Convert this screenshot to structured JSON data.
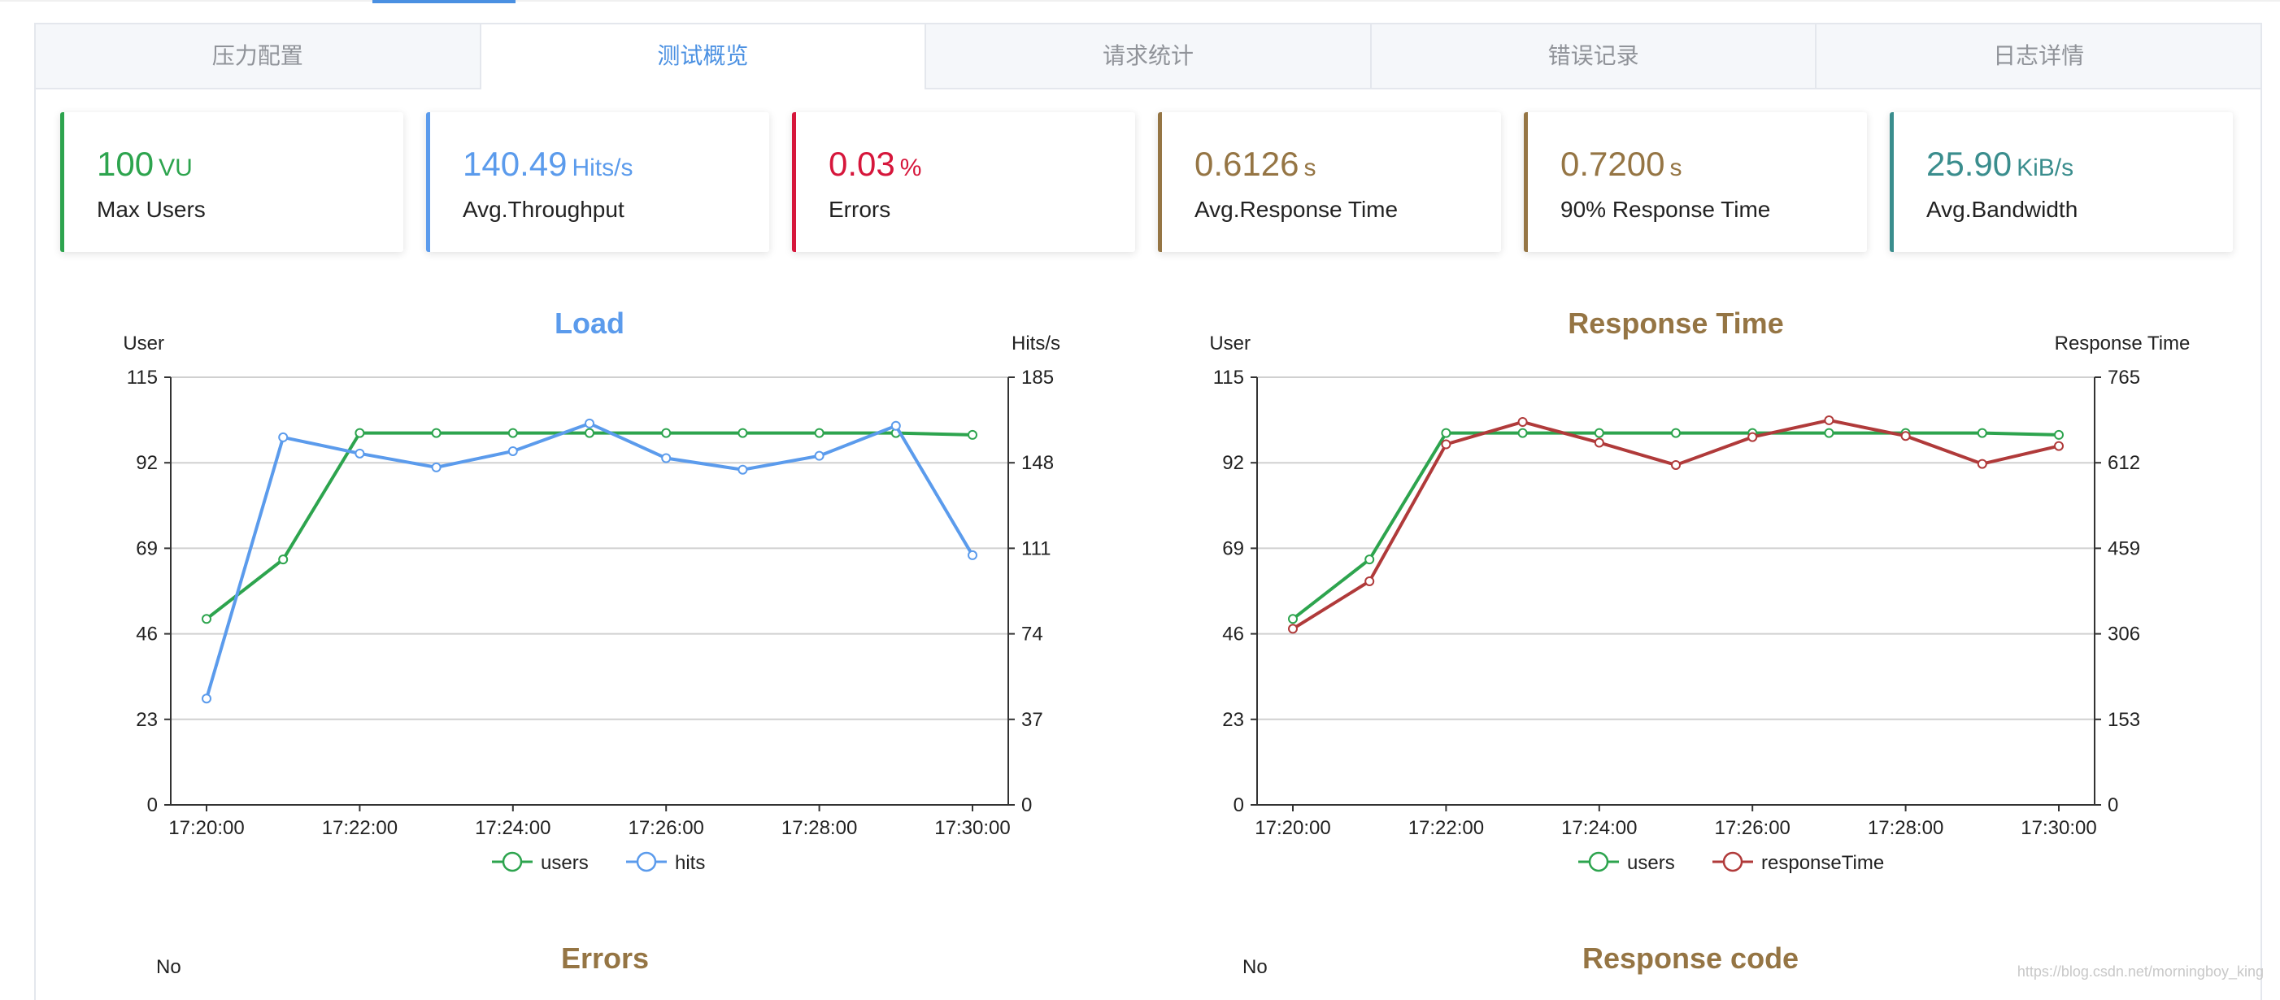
{
  "tabs": [
    {
      "label": "压力配置"
    },
    {
      "label": "测试概览"
    },
    {
      "label": "请求统计"
    },
    {
      "label": "错误记录"
    },
    {
      "label": "日志详情"
    }
  ],
  "cards": [
    {
      "value": "100",
      "unit": "VU",
      "label": "Max Users",
      "color": "#2da44e"
    },
    {
      "value": "140.49",
      "unit": "Hits/s",
      "label": "Avg.Throughput",
      "color": "#5b9bec"
    },
    {
      "value": "0.03",
      "unit": "%",
      "label": "Errors",
      "color": "#d6163b"
    },
    {
      "value": "0.6126",
      "unit": "s",
      "label": "Avg.Response Time",
      "color": "#957544"
    },
    {
      "value": "0.7200",
      "unit": "s",
      "label": "90% Response Time",
      "color": "#957544"
    },
    {
      "value": "25.90",
      "unit": "KiB/s",
      "label": "Avg.Bandwidth",
      "color": "#3a8d8d"
    }
  ],
  "chart_data": [
    {
      "type": "line",
      "title": "Load",
      "title_color": "#5b9bec",
      "ylabel_left": "User",
      "ylabel_right": "Hits/s",
      "x_ticks": [
        "17:20:00",
        "17:22:00",
        "17:24:00",
        "17:26:00",
        "17:28:00",
        "17:30:00"
      ],
      "x": [
        "17:20:00",
        "17:21:00",
        "17:22:00",
        "17:23:00",
        "17:24:00",
        "17:25:00",
        "17:26:00",
        "17:27:00",
        "17:28:00",
        "17:29:00",
        "17:30:00"
      ],
      "y_left_ticks": [
        0,
        23,
        46,
        69,
        92,
        115
      ],
      "y_right_ticks": [
        0,
        37,
        74,
        111,
        148,
        185
      ],
      "ylim_left": [
        0,
        115
      ],
      "ylim_right": [
        0,
        185
      ],
      "grid": true,
      "legend_position": "bottom-center",
      "series": [
        {
          "name": "users",
          "axis": "left",
          "color": "#2da44e",
          "values": [
            50,
            66,
            100,
            100,
            100,
            100,
            100,
            100,
            100,
            100,
            99.5
          ]
        },
        {
          "name": "hits",
          "axis": "right",
          "color": "#5b9bec",
          "values": [
            46,
            159,
            152,
            146,
            153,
            165,
            150,
            145,
            151,
            164,
            108
          ]
        }
      ]
    },
    {
      "type": "line",
      "title": "Response Time",
      "title_color": "#957544",
      "ylabel_left": "User",
      "ylabel_right": "Response Time",
      "x_ticks": [
        "17:20:00",
        "17:22:00",
        "17:24:00",
        "17:26:00",
        "17:28:00",
        "17:30:00"
      ],
      "x": [
        "17:20:00",
        "17:21:00",
        "17:22:00",
        "17:23:00",
        "17:24:00",
        "17:25:00",
        "17:26:00",
        "17:27:00",
        "17:28:00",
        "17:29:00",
        "17:30:00"
      ],
      "y_left_ticks": [
        0,
        23,
        46,
        69,
        92,
        115
      ],
      "y_right_ticks": [
        0,
        153,
        306,
        459,
        612,
        765
      ],
      "ylim_left": [
        0,
        115
      ],
      "ylim_right": [
        0,
        765
      ],
      "grid": true,
      "legend_position": "bottom-center",
      "series": [
        {
          "name": "users",
          "axis": "left",
          "color": "#2da44e",
          "values": [
            50,
            66,
            100,
            100,
            100,
            100,
            100,
            100,
            100,
            100,
            99.5
          ]
        },
        {
          "name": "responseTime",
          "axis": "right",
          "color": "#b03a3a",
          "values": [
            315,
            400,
            645,
            685,
            648,
            608,
            658,
            688,
            660,
            610,
            642
          ]
        }
      ]
    }
  ],
  "bottom_charts": [
    {
      "title": "Errors",
      "ylabel": "No"
    },
    {
      "title": "Response code",
      "ylabel": "No"
    }
  ],
  "watermark": "https://blog.csdn.net/morningboy_king"
}
